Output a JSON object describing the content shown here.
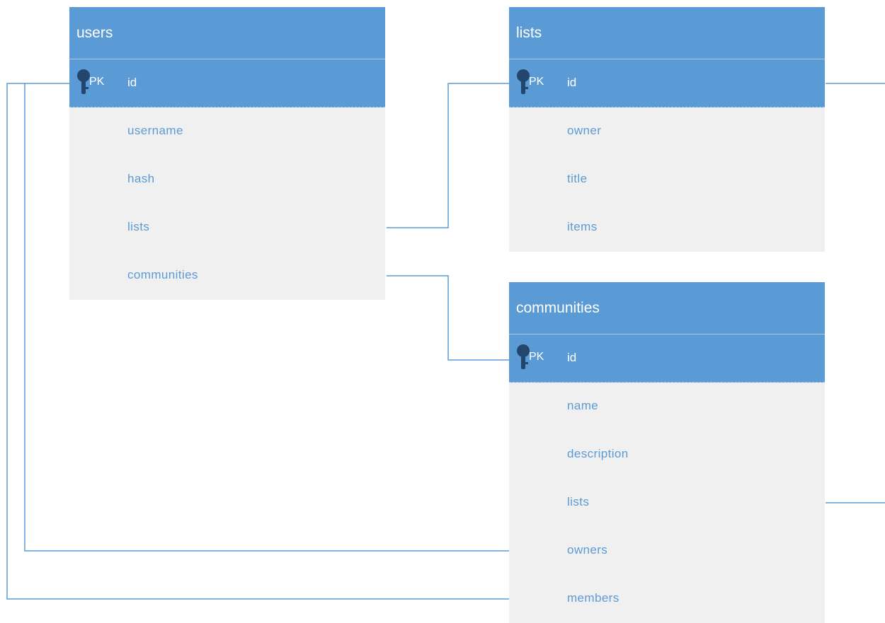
{
  "pk_label": "PK",
  "colors": {
    "header": "#5b9bd5",
    "body": "#f0f0f0",
    "field_text": "#5b9bd5",
    "line": "#5b9bd5"
  },
  "icons": {
    "primary_key": "key-icon"
  },
  "entities": {
    "users": {
      "title": "users",
      "pk": "id",
      "fields": [
        "username",
        "hash",
        "lists",
        "communities"
      ]
    },
    "lists": {
      "title": "lists",
      "pk": "id",
      "fields": [
        "owner",
        "title",
        "items"
      ]
    },
    "communities": {
      "title": "communities",
      "pk": "id",
      "fields": [
        "name",
        "description",
        "lists",
        "owners",
        "members"
      ]
    }
  },
  "relationships": [
    {
      "from": "users.lists",
      "to": "lists.id"
    },
    {
      "from": "users.communities",
      "to": "communities.id"
    },
    {
      "from": "users.id",
      "to": "communities.owners"
    },
    {
      "from": "users.id",
      "to": "communities.members"
    },
    {
      "from": "lists.id",
      "to": "communities.lists"
    }
  ]
}
